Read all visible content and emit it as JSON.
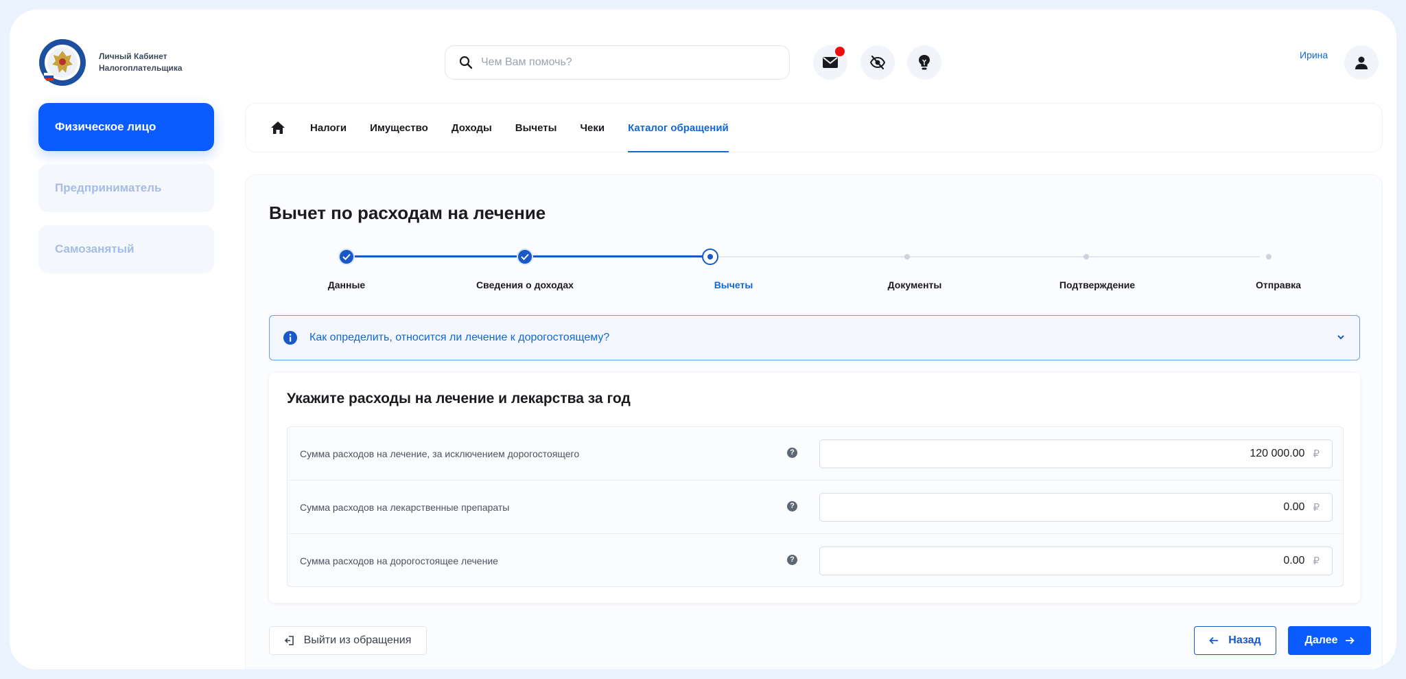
{
  "header": {
    "logo_text": "Личный Кабинет Налогоплательщика",
    "search_placeholder": "Чем Вам помочь?",
    "user_name": "Ирина",
    "icons": [
      "mail-icon",
      "hide-icon",
      "lightbulb-icon",
      "user-icon"
    ]
  },
  "sidebar": {
    "items": [
      {
        "label": "Физическое лицо",
        "active": true
      },
      {
        "label": "Предприниматель",
        "active": false
      },
      {
        "label": "Самозанятый",
        "active": false
      }
    ]
  },
  "topnav": {
    "items": [
      "Налоги",
      "Имущество",
      "Доходы",
      "Вычеты",
      "Чеки",
      "Каталог обращений"
    ],
    "active": "Каталог обращений"
  },
  "page": {
    "title": "Вычет по расходам на лечение"
  },
  "stepper": {
    "steps": [
      {
        "label": "Данные",
        "state": "done"
      },
      {
        "label": "Сведения о доходах",
        "state": "done"
      },
      {
        "label": "Вычеты",
        "state": "current"
      },
      {
        "label": "Документы",
        "state": "pending"
      },
      {
        "label": "Подтверждение",
        "state": "pending"
      },
      {
        "label": "Отправка",
        "state": "pending"
      }
    ]
  },
  "info_banner": {
    "text": "Как определить, относится ли лечение к дорогостоящему?"
  },
  "form": {
    "title": "Укажите расходы на лечение и лекарства за год",
    "help_glyph": "?",
    "rows": [
      {
        "label": "Сумма расходов на лечение, за исключением дорогостоящего",
        "value": "120 000.00",
        "currency": "₽"
      },
      {
        "label": "Сумма расходов на лекарственные препараты",
        "value": "0.00",
        "currency": "₽"
      },
      {
        "label": "Сумма расходов на дорогостоящее лечение",
        "value": "0.00",
        "currency": "₽"
      }
    ]
  },
  "buttons": {
    "exit": "Выйти из обращения",
    "back": "Назад",
    "next": "Далее"
  },
  "colors": {
    "accent": "#0a5cff",
    "link": "#1266d6",
    "notification": "#ee0d0d"
  }
}
